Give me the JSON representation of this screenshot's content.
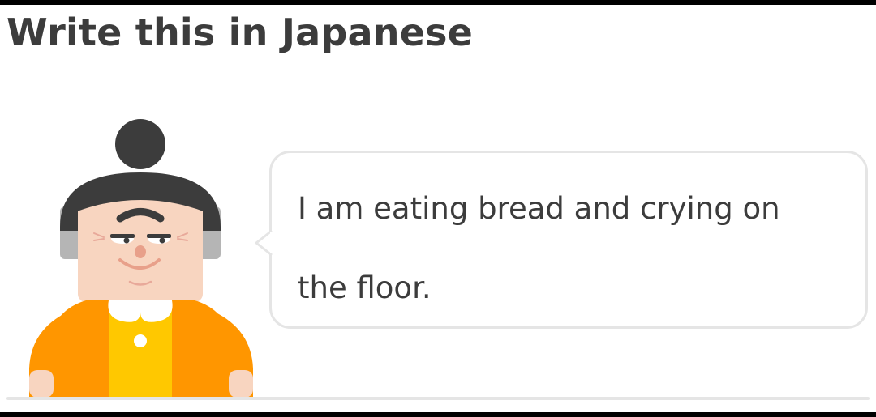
{
  "prompt": {
    "title": "Write this in Japanese"
  },
  "speech_bubble": {
    "sentence": "I am eating bread and crying on the floor."
  },
  "character": {
    "icon": "lily-character-icon"
  },
  "colors": {
    "title_text": "#3c3c3c",
    "bubble_border": "#e5e5e5",
    "hair": "#3c3c3c",
    "hair_gray": "#b5b5b5",
    "skin": "#f8d5c0",
    "shirt_orange": "#ff9600",
    "shirt_light": "#ffc800",
    "collar": "#ffffff"
  }
}
